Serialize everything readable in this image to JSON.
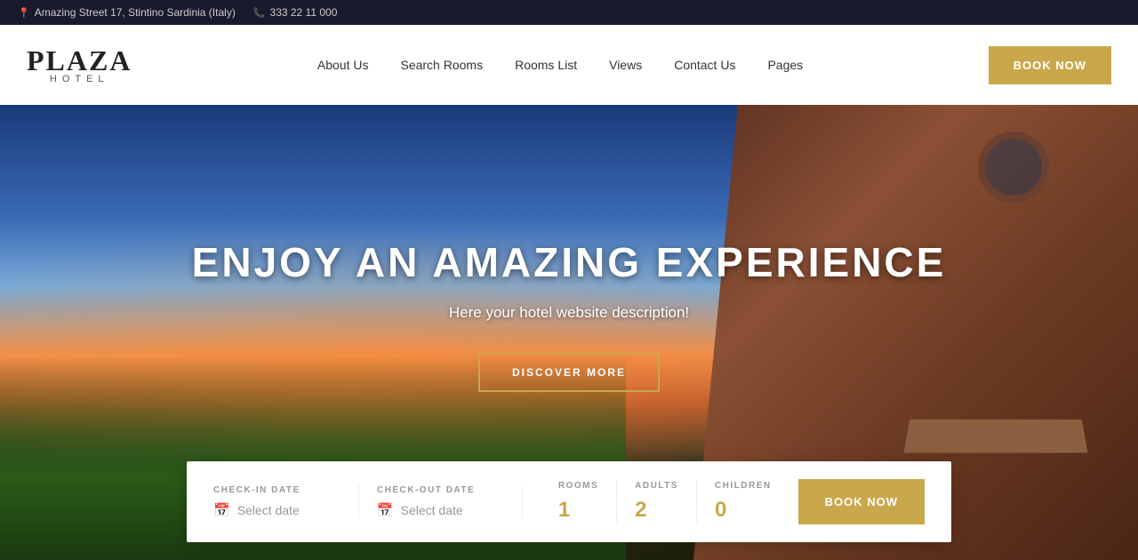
{
  "topbar": {
    "address": "Amazing Street 17, Stintino Sardinia (Italy)",
    "phone": "333 22 11 000",
    "address_icon": "📍",
    "phone_icon": "📞"
  },
  "header": {
    "logo_plaza": "PLAZA",
    "logo_hotel": "HOTEL",
    "nav": [
      {
        "label": "About Us",
        "id": "about-us"
      },
      {
        "label": "Search Rooms",
        "id": "search-rooms"
      },
      {
        "label": "Rooms List",
        "id": "rooms-list"
      },
      {
        "label": "Views",
        "id": "views"
      },
      {
        "label": "Contact Us",
        "id": "contact-us"
      },
      {
        "label": "Pages",
        "id": "pages"
      }
    ],
    "book_now": "BOOK NOW"
  },
  "hero": {
    "title": "ENJOY AN AMAZING EXPERIENCE",
    "subtitle": "Here your hotel website description!",
    "discover_btn": "DISCOVER MORE"
  },
  "booking": {
    "checkin_label": "CHECK-IN DATE",
    "checkin_placeholder": "Select date",
    "checkout_label": "CHECK-OUT DATE",
    "checkout_placeholder": "Select date",
    "rooms_label": "ROOMS",
    "rooms_value": "1",
    "adults_label": "ADULTS",
    "adults_value": "2",
    "children_label": "CHILDREN",
    "children_value": "0",
    "book_btn": "BOOK NOW"
  }
}
